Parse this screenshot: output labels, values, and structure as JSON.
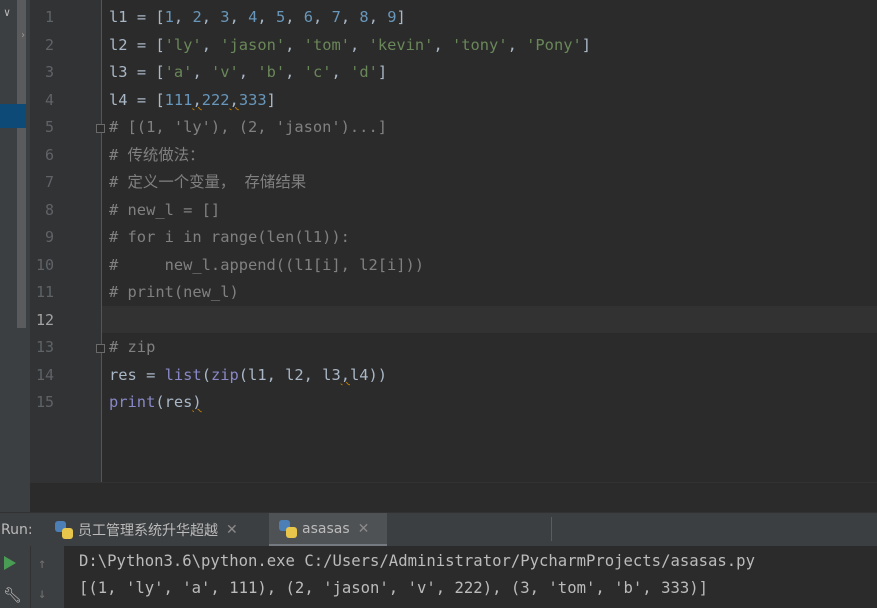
{
  "editor": {
    "line_numbers": [
      "1",
      "2",
      "3",
      "4",
      "5",
      "6",
      "7",
      "8",
      "9",
      "10",
      "11",
      "12",
      "13",
      "14",
      "15"
    ],
    "active_line": "12",
    "lines": {
      "l1": {
        "name": "l1",
        "op": " = [",
        "v": [
          "1",
          "2",
          "3",
          "4",
          "5",
          "6",
          "7",
          "8",
          "9"
        ],
        "close": "]"
      },
      "l2": {
        "name": "l2",
        "op": " = [",
        "v": [
          "'ly'",
          "'jason'",
          "'tom'",
          "'kevin'",
          "'tony'",
          "'Pony'"
        ],
        "close": "]"
      },
      "l3": {
        "name": "l3",
        "op": " = [",
        "v": [
          "'a'",
          "'v'",
          "'b'",
          "'c'",
          "'d'"
        ],
        "close": "]"
      },
      "l4": {
        "name": "l4",
        "op": " = [",
        "v": [
          "111",
          "222",
          "333"
        ],
        "close": "]"
      },
      "c5": "# [(1, 'ly'), (2, 'jason')...]",
      "c6": "# 传统做法：",
      "c7": "# 定义一个变量， 存储结果",
      "c8": "# new_l = []",
      "c9": "# for i in range(len(l1)):",
      "c10": "#     new_l.append((l1[i], l2[i]))",
      "c11": "# print(new_l)",
      "c13": "# zip",
      "l14": {
        "a": "res = ",
        "list": "list",
        "p1": "(",
        "zip": "zip",
        "args": "(l1, l2, l3",
        "comma": ",",
        "l4": "l4))"
      },
      "l15": {
        "print": "print",
        "args": "(res",
        ")": ")"
      }
    }
  },
  "run": {
    "label": "Run:",
    "tabs": [
      {
        "label": "员工管理系统升华超越",
        "close": "✕"
      },
      {
        "label": "asasas",
        "close": "✕"
      }
    ]
  },
  "console": {
    "lines": [
      "D:\\Python3.6\\python.exe C:/Users/Administrator/PycharmProjects/asasas.py",
      "[(1, 'ly', 'a', 111), (2, 'jason', 'v', 222), (3, 'tom', 'b', 333)]"
    ]
  },
  "icons": {
    "run": "play-icon",
    "settings": "wrench-icon",
    "up": "arrow-up-icon",
    "down": "arrow-down-icon",
    "python": "python-icon"
  },
  "colors": {
    "number": "#6897bb",
    "string": "#6a8759",
    "comment": "#808080",
    "builtin": "#8888c6",
    "text": "#a9b7c6",
    "run_green": "#499c54"
  }
}
